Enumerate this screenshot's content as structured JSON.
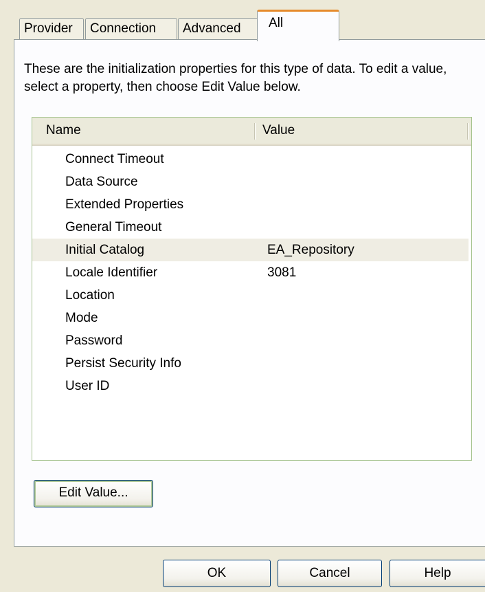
{
  "tabs": [
    {
      "label": "Provider",
      "active": false
    },
    {
      "label": "Connection",
      "active": false
    },
    {
      "label": "Advanced",
      "active": false
    },
    {
      "label": "All",
      "active": true
    }
  ],
  "description": "These are the initialization properties for this type of data. To edit a value, select a property, then choose Edit Value below.",
  "list": {
    "columns": [
      "Name",
      "Value"
    ],
    "rows": [
      {
        "name": "Connect Timeout",
        "value": ""
      },
      {
        "name": "Data Source",
        "value": ""
      },
      {
        "name": "Extended Properties",
        "value": ""
      },
      {
        "name": "General Timeout",
        "value": ""
      },
      {
        "name": "Initial Catalog",
        "value": "EA_Repository",
        "selected": true
      },
      {
        "name": "Locale Identifier",
        "value": "3081"
      },
      {
        "name": "Location",
        "value": ""
      },
      {
        "name": "Mode",
        "value": ""
      },
      {
        "name": "Password",
        "value": ""
      },
      {
        "name": "Persist Security Info",
        "value": ""
      },
      {
        "name": "User ID",
        "value": ""
      }
    ]
  },
  "buttons": {
    "edit_value": "Edit Value...",
    "ok": "OK",
    "cancel": "Cancel",
    "help": "Help"
  },
  "colors": {
    "dialog_bg": "#ece9d8",
    "active_tab_accent": "#e68b2c",
    "selected_row_bg": "#efede3"
  }
}
